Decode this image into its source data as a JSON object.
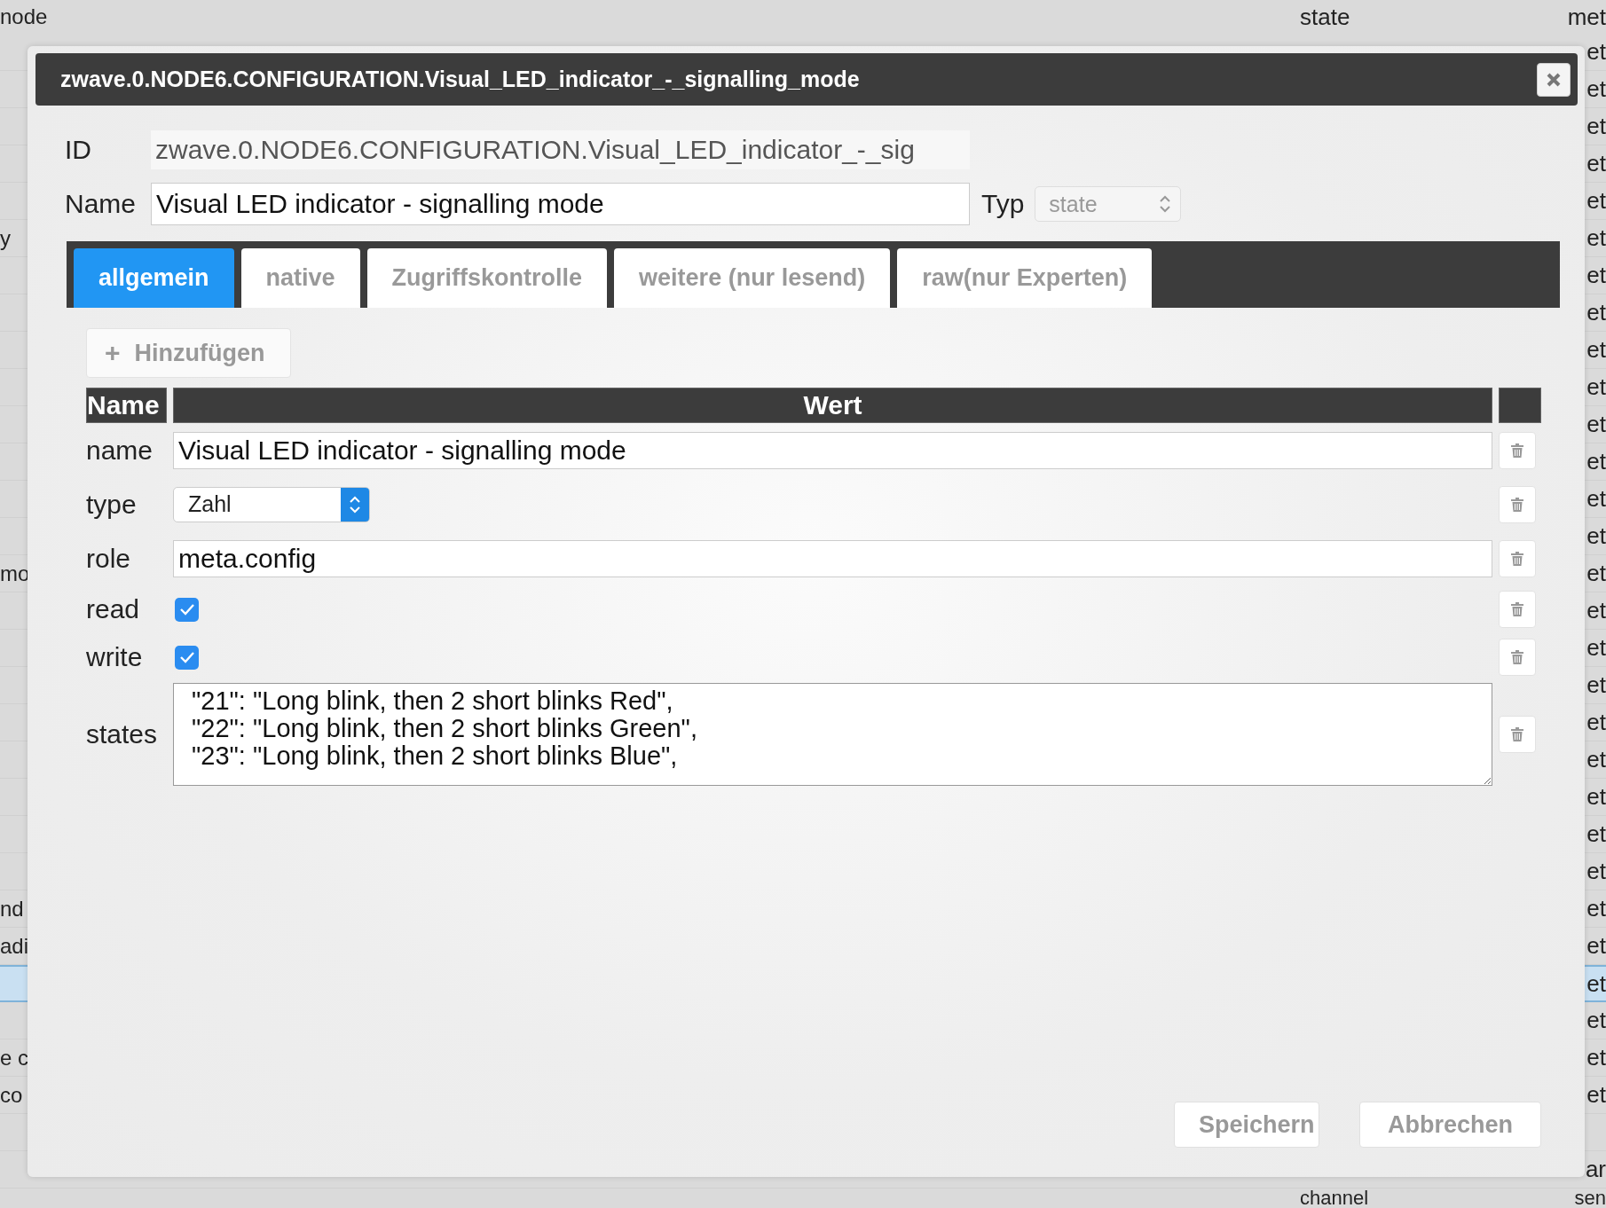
{
  "background_table": {
    "header": {
      "col_1": "node",
      "col_2": "state",
      "col_3": "met"
    },
    "rows": [
      {
        "col_1": "",
        "col_3": "et",
        "selected": false
      },
      {
        "col_1": "",
        "col_3": "et",
        "selected": false
      },
      {
        "col_1": "",
        "col_3": "et",
        "selected": false
      },
      {
        "col_1": "",
        "col_3": "et",
        "selected": false
      },
      {
        "col_1": "",
        "col_3": "et",
        "selected": false
      },
      {
        "col_1": "y",
        "col_3": "et",
        "selected": false
      },
      {
        "col_1": "",
        "col_3": "et",
        "selected": false
      },
      {
        "col_1": "",
        "col_3": "et",
        "selected": false
      },
      {
        "col_1": "",
        "col_3": "et",
        "selected": false
      },
      {
        "col_1": "",
        "col_3": "et",
        "selected": false
      },
      {
        "col_1": "",
        "col_3": "et",
        "selected": false
      },
      {
        "col_1": "",
        "col_3": "et",
        "selected": false
      },
      {
        "col_1": "",
        "col_3": "et",
        "selected": false
      },
      {
        "col_1": "",
        "col_3": "et",
        "selected": false
      },
      {
        "col_1": "mo",
        "col_3": "et",
        "selected": false
      },
      {
        "col_1": "",
        "col_3": "et",
        "selected": false
      },
      {
        "col_1": "",
        "col_3": "et",
        "selected": false
      },
      {
        "col_1": "",
        "col_3": "et",
        "selected": false
      },
      {
        "col_1": "",
        "col_3": "et",
        "selected": false
      },
      {
        "col_1": "",
        "col_3": "et",
        "selected": false
      },
      {
        "col_1": "",
        "col_3": "et",
        "selected": false
      },
      {
        "col_1": "",
        "col_3": "et",
        "selected": false
      },
      {
        "col_1": "",
        "col_3": "et",
        "selected": false
      },
      {
        "col_1": "nd",
        "col_3": "et",
        "selected": false
      },
      {
        "col_1": "adi",
        "col_3": "et",
        "selected": false
      },
      {
        "col_1": "",
        "col_3": "et",
        "selected": true
      },
      {
        "col_1": "",
        "col_3": "et",
        "selected": false
      },
      {
        "col_1": "e c",
        "col_3": "et",
        "selected": false
      },
      {
        "col_1": "co",
        "col_3": "et",
        "selected": false
      },
      {
        "col_1": "",
        "col_3": "",
        "selected": false
      },
      {
        "col_1": "",
        "col_3": "ar",
        "selected": false
      },
      {
        "col_1": "",
        "col_2": "channel",
        "col_3": "sen",
        "selected": false
      }
    ]
  },
  "dialog": {
    "title": "zwave.0.NODE6.CONFIGURATION.Visual_LED_indicator_-_signalling_mode",
    "id_label": "ID",
    "id_value": "zwave.0.NODE6.CONFIGURATION.Visual_LED_indicator_-_sig",
    "name_label": "Name",
    "name_value": "Visual LED indicator - signalling mode",
    "type_label": "Typ",
    "type_value": "state",
    "tabs": [
      {
        "label": "allgemein",
        "selected": true
      },
      {
        "label": "native",
        "selected": false
      },
      {
        "label": "Zugriffskontrolle",
        "selected": false
      },
      {
        "label": "weitere (nur lesend)",
        "selected": false
      },
      {
        "label": "raw(nur Experten)",
        "selected": false
      }
    ],
    "add_button": {
      "icon": "+",
      "label": "Hinzufügen"
    },
    "table": {
      "columns": [
        "Name",
        "Wert"
      ],
      "rows": [
        {
          "name": "name",
          "kind": "input",
          "value": "Visual LED indicator - signalling mode"
        },
        {
          "name": "type",
          "kind": "select",
          "value": "Zahl"
        },
        {
          "name": "role",
          "kind": "input",
          "value": "meta.config"
        },
        {
          "name": "read",
          "kind": "checkbox",
          "checked": true
        },
        {
          "name": "write",
          "kind": "checkbox",
          "checked": true
        },
        {
          "name": "states",
          "kind": "textarea",
          "value": "\"21\": \"Long blink, then 2 short blinks Red\",\n\"22\": \"Long blink, then 2 short blinks Green\",\n\"23\": \"Long blink, then 2 short blinks Blue\","
        }
      ]
    },
    "buttons": [
      "Speichern",
      "Abbrechen"
    ]
  }
}
